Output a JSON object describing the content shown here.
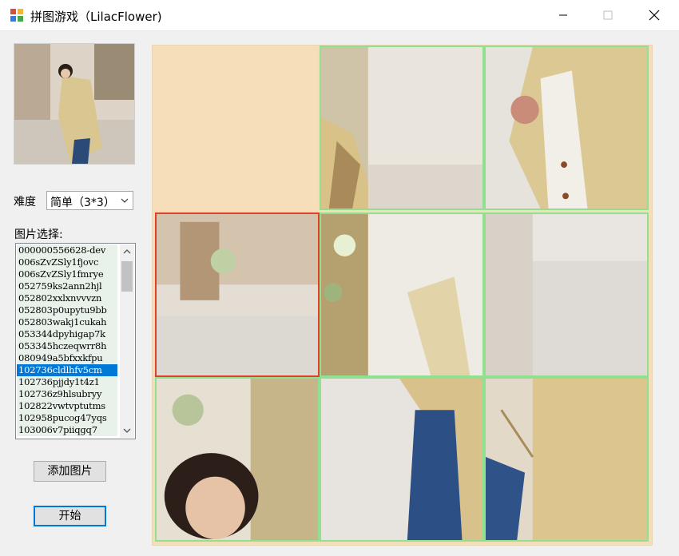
{
  "window": {
    "title": "拼图游戏（LilacFlower)",
    "controls": [
      "minimize",
      "maximize",
      "close"
    ]
  },
  "left_panel": {
    "difficulty_label": "难度",
    "difficulty_selected": "简单（3*3）",
    "picture_label": "图片选择:",
    "images": [
      "000000556628-dev",
      "006sZvZSly1fjovc",
      "006sZvZSly1fmrye",
      "052759ks2ann2hjl",
      "052802xxlxnvvvzn",
      "052803p0upytu9bb",
      "052803wakj1cukah",
      "053344dpyhigap7k",
      "053345hczeqwrr8h",
      "080949a5bfxxkfpu",
      "102736cldlhfv5cm",
      "102736pjjdy1t4z1",
      "102736z9hlsubryy",
      "102822vwtvptutms",
      "102958pucog47yqs",
      "103006v7piiqgq7"
    ],
    "selected_index": 10,
    "add_button": "添加图片",
    "start_button": "开始"
  },
  "board": {
    "grid": "3x3",
    "empty_cell": 0,
    "active_cell": 3,
    "colors": {
      "empty": "#f5deb8",
      "tile_border": "#90e090",
      "active_border": "#e0402a"
    }
  }
}
